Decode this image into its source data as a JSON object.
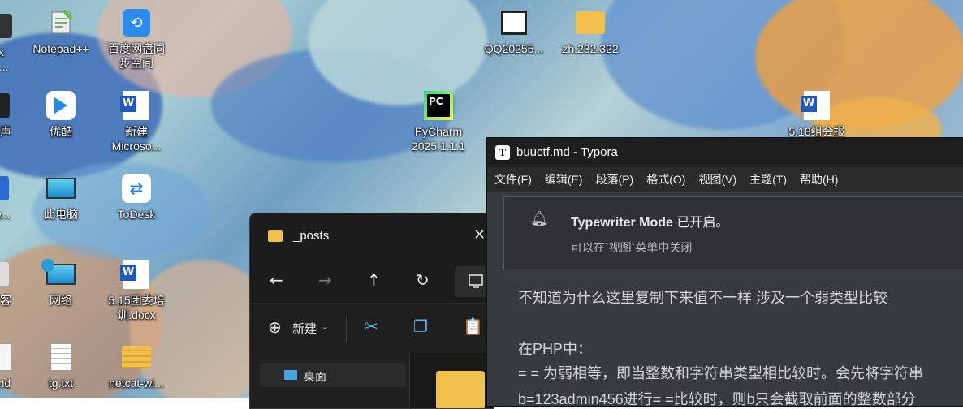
{
  "desktop": {
    "icons": [
      {
        "label": "ix\nA...",
        "icon": "app-icon"
      },
      {
        "label": "Notepad++",
        "icon": "notepad-icon"
      },
      {
        "label": "百度网盘同\n步空间",
        "icon": "baidu-netdisk-icon"
      },
      {
        "label": "QQ20255...",
        "icon": "video-file-icon"
      },
      {
        "label": "zh.232.322",
        "icon": "folder-icon"
      },
      {
        "label": "大声",
        "icon": "app-icon"
      },
      {
        "label": "优酷",
        "icon": "youku-icon"
      },
      {
        "label": "新建\nMicroso...",
        "icon": "word-doc-icon"
      },
      {
        "label": "PyCharm\n2025.1.1.1",
        "icon": "pycharm-icon"
      },
      {
        "label": "5.18组会报",
        "icon": "word-doc-icon"
      },
      {
        "label": "dy...",
        "icon": "app-icon"
      },
      {
        "label": "此电脑",
        "icon": "this-pc-icon"
      },
      {
        "label": "ToDesk",
        "icon": "todesk-icon"
      },
      {
        "label": "试客",
        "icon": "app-icon"
      },
      {
        "label": "网络",
        "icon": "network-icon"
      },
      {
        "label": "5.15团委培\n训.docx",
        "icon": "word-doc-icon"
      },
      {
        "label": "l.md",
        "icon": "md-file-icon"
      },
      {
        "label": "tg.txt",
        "icon": "text-file-icon"
      },
      {
        "label": "netcat-wi...",
        "icon": "zip-folder-icon"
      }
    ]
  },
  "explorer": {
    "title": "_posts",
    "new_label": "新建",
    "sidebar_item": "桌面"
  },
  "typora": {
    "title": "buuctf.md - Typora",
    "menu": [
      "文件(F)",
      "编辑(E)",
      "段落(P)",
      "格式(O)",
      "视图(V)",
      "主题(T)",
      "帮助(H)"
    ],
    "notice": {
      "mode": "Typewriter Mode",
      "status": " 已开启。",
      "hint": "可以在`视图`菜单中关闭"
    },
    "content": {
      "line1_prefix": "不知道为什么这里复制下来值不一样 涉及一个",
      "line1_link": "弱类型比较",
      "line2": "在PHP中：",
      "line3": "= = 为弱相等，即当整数和字符串类型相比较时。会先将字符串",
      "line4": "b=123admin456进行= =比较时，则b只会截取前面的整数部分"
    }
  },
  "colors": {
    "typora_bg": "#363b40",
    "explorer_bg": "#202020",
    "folder": "#f2c04d"
  }
}
